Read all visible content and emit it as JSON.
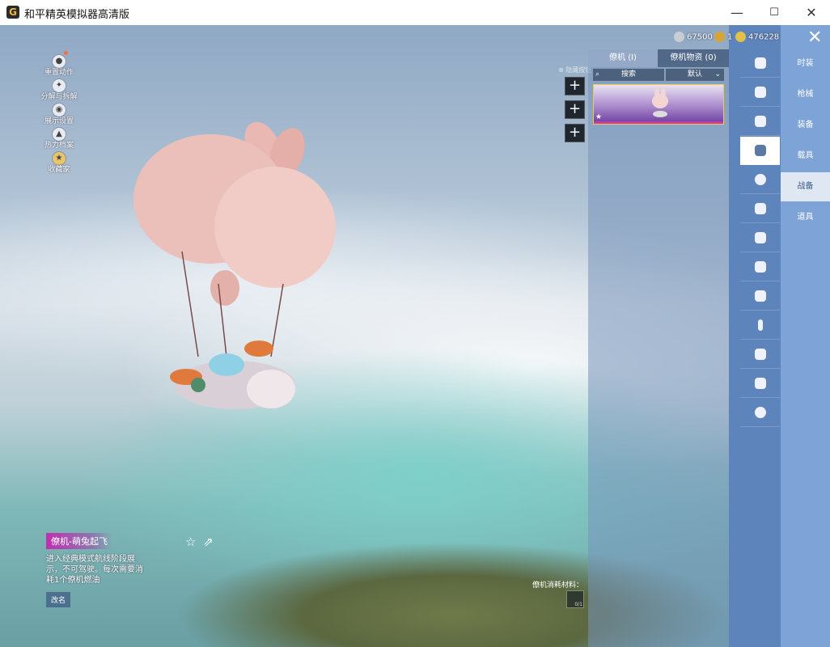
{
  "window": {
    "title": "和平精英模拟器高清版",
    "controls": {
      "minimize": "—",
      "maximize": "☐",
      "close": "✕"
    }
  },
  "left_tools": [
    {
      "label": "重置动作",
      "icon": "user-reset-icon",
      "has_dot": true
    },
    {
      "label": "分解与拆解",
      "icon": "gear-split-icon",
      "has_dot": false
    },
    {
      "label": "展示设置",
      "icon": "eye-icon",
      "has_dot": false
    },
    {
      "label": "热力档案",
      "icon": "heat-archive-icon",
      "has_dot": false
    },
    {
      "label": "收藏家",
      "icon": "collector-badge-icon",
      "has_dot": false
    }
  ],
  "preview_hint": "⊗ 隐藏按钮",
  "plus_buttons": [
    "+",
    "+",
    "+"
  ],
  "currency": [
    {
      "value": "67500",
      "icon": "silver-coin-icon",
      "color": "#c9ccd2"
    },
    {
      "value": "1",
      "icon": "gold-coin-icon",
      "color": "#d8a43a"
    },
    {
      "value": "476228",
      "icon": "gold-shield-icon",
      "color": "#e2c04a"
    }
  ],
  "panel": {
    "tabs": [
      {
        "label": "僚机 (I)",
        "active": true
      },
      {
        "label": "僚机物资 (0)",
        "active": false
      }
    ],
    "search_placeholder": "搜索",
    "sort_label": "默认",
    "card": {
      "name": "僚机-萌兔起飞",
      "selected": true
    }
  },
  "category_icons": [
    "outfit-icon",
    "gun-icon",
    "rifle-icon",
    "plane-icon",
    "emote-icon",
    "robot-icon",
    "voice-icon",
    "tv-icon",
    "photo-icon",
    "spray-icon",
    "gesture-icon",
    "magic-icon",
    "ufo-icon"
  ],
  "active_category_index": 3,
  "menu": [
    {
      "label": "时装",
      "active": false
    },
    {
      "label": "枪械",
      "active": false
    },
    {
      "label": "装备",
      "active": false
    },
    {
      "label": "载具",
      "active": false
    },
    {
      "label": "战备",
      "active": true
    },
    {
      "label": "道具",
      "active": false
    }
  ],
  "item": {
    "title": "僚机-萌兔起飞",
    "description": "进入经典模式航线阶段展示，不可驾驶。每次需要消耗1个僚机燃油",
    "rename_label": "改名",
    "favorite_icon": "star-icon",
    "share_icon": "share-icon"
  },
  "materials": {
    "label": "僚机消耗材料：",
    "count": "0/1"
  }
}
